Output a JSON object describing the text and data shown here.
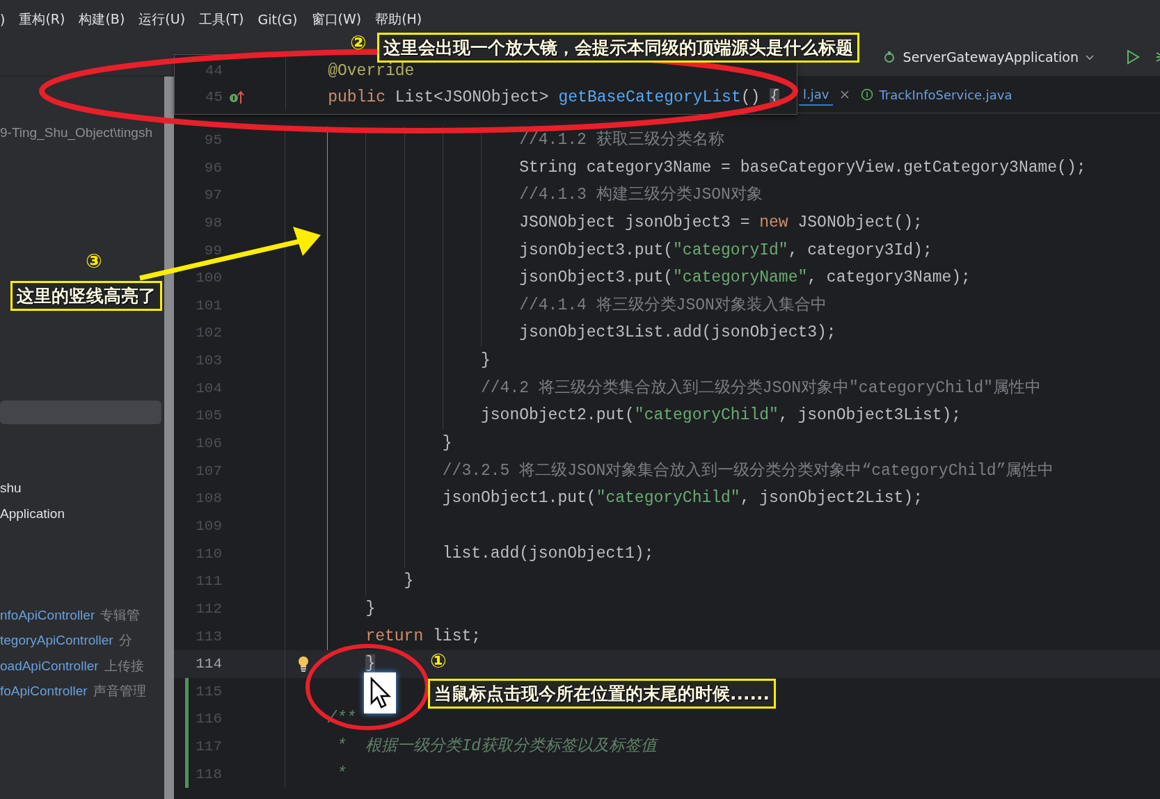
{
  "menu_bar": {
    "items": [
      ")",
      "重构(R)",
      "构建(B)",
      "运行(U)",
      "工具(T)",
      "Git(G)",
      "窗口(W)",
      "帮助(H)"
    ]
  },
  "toolbar": {
    "run_configuration": "ServerGatewayApplication"
  },
  "project_panel": {
    "path": "9-Ting_Shu_Object\\tingsh",
    "items": [
      {
        "name": "shu",
        "kind": "module"
      },
      {
        "name": "Application",
        "kind": "module"
      },
      {
        "name": "nfoApiController",
        "description": "专辑管",
        "kind": "class"
      },
      {
        "name": "tegoryApiController",
        "description": "分",
        "kind": "class"
      },
      {
        "name": "oadApiController",
        "description": "上传接",
        "kind": "class"
      },
      {
        "name": "foApiController",
        "description": "声音管理",
        "kind": "class"
      }
    ]
  },
  "editor_tabs": [
    {
      "label": "l.jav",
      "selected": true
    },
    {
      "label": "TrackInfoService.java",
      "selected": false
    }
  ],
  "sticky_lines": [
    {
      "number": "44",
      "override_marker": false,
      "tokens": [
        {
          "text": "    @Override",
          "kind": "annotation"
        }
      ]
    },
    {
      "number": "45",
      "override_marker": true,
      "tokens": [
        {
          "text": "    public",
          "kind": "keyword"
        },
        {
          "text": " List<JSONObject> ",
          "kind": "plain"
        },
        {
          "text": "getBaseCategoryList",
          "kind": "method"
        },
        {
          "text": "() ",
          "kind": "plain"
        },
        {
          "text": "{",
          "kind": "brace"
        }
      ]
    }
  ],
  "code_lines": [
    {
      "number": "95",
      "current": false,
      "changed": false,
      "intention": false,
      "tokens": [
        {
          "text": "                        //4.1.2 获取三级分类名称",
          "kind": "comment"
        }
      ]
    },
    {
      "number": "96",
      "current": false,
      "changed": false,
      "intention": false,
      "tokens": [
        {
          "text": "                        String category3Name = baseCategoryView.getCategory3Name();",
          "kind": "plain"
        }
      ]
    },
    {
      "number": "97",
      "current": false,
      "changed": false,
      "intention": false,
      "tokens": [
        {
          "text": "                        //4.1.3 构建三级分类JSON对象",
          "kind": "comment"
        }
      ]
    },
    {
      "number": "98",
      "current": false,
      "changed": false,
      "intention": false,
      "tokens": [
        {
          "text": "                        JSONObject jsonObject3 = ",
          "kind": "plain"
        },
        {
          "text": "new",
          "kind": "keyword"
        },
        {
          "text": " JSONObject();",
          "kind": "plain"
        }
      ]
    },
    {
      "number": "99",
      "current": false,
      "changed": false,
      "intention": false,
      "tokens": [
        {
          "text": "                        jsonObject3.put(",
          "kind": "plain"
        },
        {
          "text": "\"categoryId\"",
          "kind": "string"
        },
        {
          "text": ", category3Id);",
          "kind": "plain"
        }
      ]
    },
    {
      "number": "100",
      "current": false,
      "changed": false,
      "intention": false,
      "tokens": [
        {
          "text": "                        jsonObject3.put(",
          "kind": "plain"
        },
        {
          "text": "\"categoryName\"",
          "kind": "string"
        },
        {
          "text": ", category3Name);",
          "kind": "plain"
        }
      ]
    },
    {
      "number": "101",
      "current": false,
      "changed": false,
      "intention": false,
      "tokens": [
        {
          "text": "                        //4.1.4 将三级分类JSON对象装入集合中",
          "kind": "comment"
        }
      ]
    },
    {
      "number": "102",
      "current": false,
      "changed": false,
      "intention": false,
      "tokens": [
        {
          "text": "                        jsonObject3List.add(jsonObject3);",
          "kind": "plain"
        }
      ]
    },
    {
      "number": "103",
      "current": false,
      "changed": false,
      "intention": false,
      "tokens": [
        {
          "text": "                    }",
          "kind": "plain"
        }
      ]
    },
    {
      "number": "104",
      "current": false,
      "changed": false,
      "intention": false,
      "tokens": [
        {
          "text": "                    //4.2 将三级分类集合放入到二级分类JSON对象中\"categoryChild\"属性中",
          "kind": "comment"
        }
      ]
    },
    {
      "number": "105",
      "current": false,
      "changed": false,
      "intention": false,
      "tokens": [
        {
          "text": "                    jsonObject2.put(",
          "kind": "plain"
        },
        {
          "text": "\"categoryChild\"",
          "kind": "string"
        },
        {
          "text": ", jsonObject3List);",
          "kind": "plain"
        }
      ]
    },
    {
      "number": "106",
      "current": false,
      "changed": false,
      "intention": false,
      "tokens": [
        {
          "text": "                }",
          "kind": "plain"
        }
      ]
    },
    {
      "number": "107",
      "current": false,
      "changed": false,
      "intention": false,
      "tokens": [
        {
          "text": "                //3.2.5 将二级JSON对象集合放入到一级分类分类对象中“categoryChild”属性中",
          "kind": "comment"
        }
      ]
    },
    {
      "number": "108",
      "current": false,
      "changed": false,
      "intention": false,
      "tokens": [
        {
          "text": "                jsonObject1.put(",
          "kind": "plain"
        },
        {
          "text": "\"categoryChild\"",
          "kind": "string"
        },
        {
          "text": ", jsonObject2List);",
          "kind": "plain"
        }
      ]
    },
    {
      "number": "109",
      "current": false,
      "changed": false,
      "intention": false
    },
    {
      "number": "110",
      "current": false,
      "changed": false,
      "intention": false,
      "tokens": [
        {
          "text": "                list.add(jsonObject1);",
          "kind": "plain"
        }
      ]
    },
    {
      "number": "111",
      "current": false,
      "changed": false,
      "intention": false,
      "tokens": [
        {
          "text": "            }",
          "kind": "plain"
        }
      ]
    },
    {
      "number": "112",
      "current": false,
      "changed": false,
      "intention": false,
      "tokens": [
        {
          "text": "        }",
          "kind": "plain"
        }
      ]
    },
    {
      "number": "113",
      "current": false,
      "changed": false,
      "intention": false,
      "tokens": [
        {
          "text": "        return",
          "kind": "keyword"
        },
        {
          "text": " list;",
          "kind": "plain"
        }
      ]
    },
    {
      "number": "114",
      "current": true,
      "changed": false,
      "intention": true,
      "tokens": [
        {
          "text": "        }",
          "kind": "brace"
        }
      ]
    },
    {
      "number": "115",
      "current": false,
      "changed": true,
      "intention": false
    },
    {
      "number": "116",
      "current": false,
      "changed": true,
      "intention": false,
      "tokens": [
        {
          "text": "    /**",
          "kind": "doc"
        }
      ]
    },
    {
      "number": "117",
      "current": false,
      "changed": true,
      "intention": false,
      "tokens": [
        {
          "text": "     *  根据一级分类Id获取分类标签以及标签值",
          "kind": "doc"
        }
      ]
    },
    {
      "number": "118",
      "current": false,
      "changed": true,
      "intention": false,
      "tokens": [
        {
          "text": "     *",
          "kind": "doc"
        }
      ]
    }
  ],
  "annotations": [
    {
      "number": "②",
      "text": "这里会出现一个放大镜，会提示本同级的顶端源头是什么标题"
    },
    {
      "number": "③",
      "text": "这里的竖线高亮了"
    },
    {
      "number": "①",
      "text": "当鼠标点击现今所在位置的末尾的时候......"
    }
  ]
}
